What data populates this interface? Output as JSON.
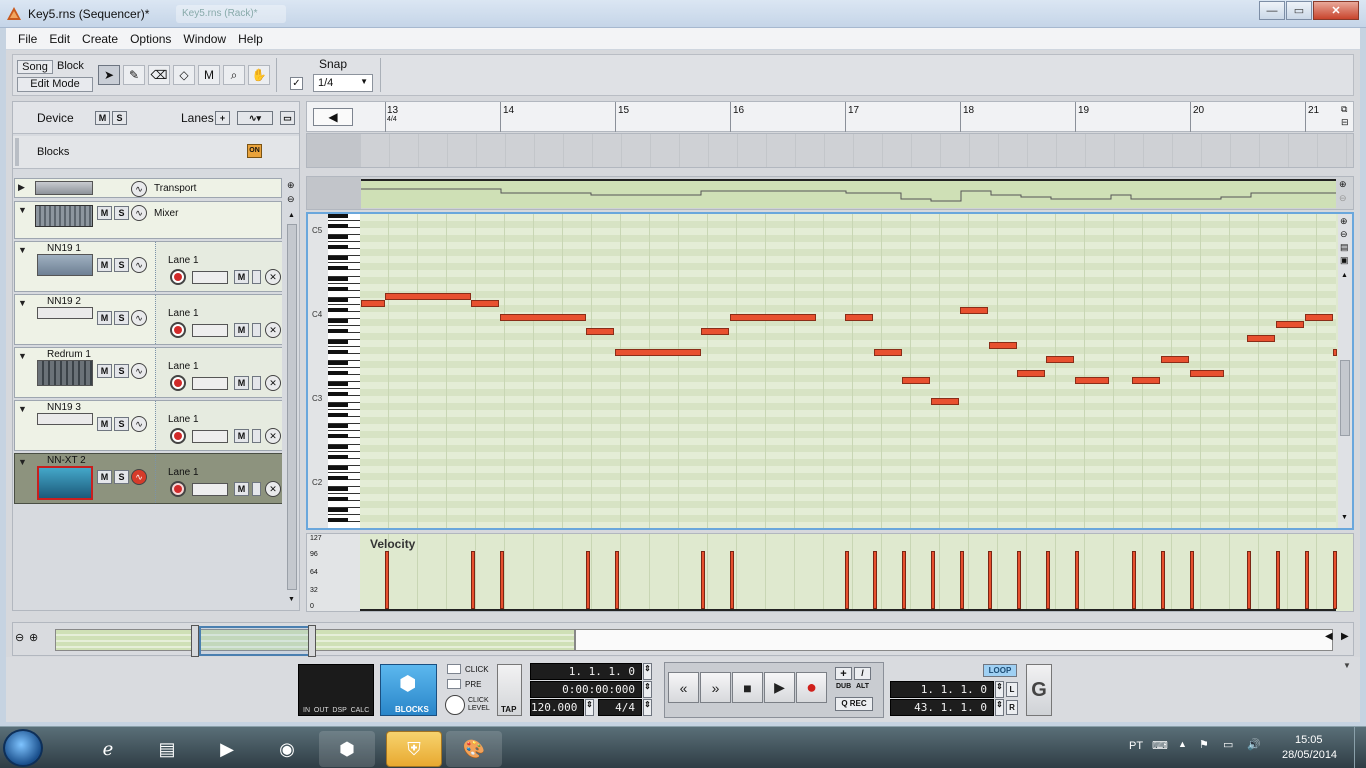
{
  "window": {
    "title": "Key5.rns (Sequencer)*",
    "background_title": "Key5.rns (Rack)*"
  },
  "menu": [
    "File",
    "Edit",
    "Create",
    "Options",
    "Window",
    "Help"
  ],
  "toolbar": {
    "song_label": "Song",
    "block_label": "Block",
    "edit_mode_label": "Edit Mode",
    "snap_label": "Snap",
    "snap_value": "1/4",
    "snap_checked": "✓"
  },
  "tracklist": {
    "device_label": "Device",
    "lanes_label": "Lanes",
    "m_label": "M",
    "s_label": "S",
    "blocks_label": "Blocks",
    "blocks_on": "ON",
    "tracks": [
      {
        "name": "Transport",
        "lane": ""
      },
      {
        "name": "Mixer",
        "lane": ""
      },
      {
        "name": "NN19 1",
        "lane": "Lane 1"
      },
      {
        "name": "NN19 2",
        "lane": "Lane 1"
      },
      {
        "name": "Redrum 1",
        "lane": "Lane 1"
      },
      {
        "name": "NN19 3",
        "lane": "Lane 1"
      },
      {
        "name": "NN-XT 2",
        "lane": "Lane 1"
      }
    ]
  },
  "ruler": {
    "bars": [
      "13",
      "14",
      "15",
      "16",
      "17",
      "18",
      "19",
      "20",
      "21"
    ],
    "time_signature": "4/4"
  },
  "pianoroll": {
    "octave_labels": [
      "C5",
      "C4",
      "C3",
      "C2"
    ]
  },
  "velocity": {
    "title": "Velocity",
    "scale": [
      "127",
      "96",
      "64",
      "32",
      "0"
    ]
  },
  "transport": {
    "click_label": "CLICK",
    "pre_label": "PRE",
    "click_level_label": "CLICK LEVEL",
    "tap_label": "TAP",
    "blocks_label": "BLOCKS",
    "io_labels": "IN  OUT  DSP  CALC",
    "position": "1. 1. 1.   0",
    "time": "0:00:00:000",
    "tempo": "120.000",
    "signature": "4/4",
    "dub_label": "DUB",
    "alt_label": "ALT",
    "qrec_label": "Q REC",
    "loop_label": "LOOP",
    "loop_left": "1. 1. 1.   0",
    "loop_right": "43. 1. 1.   0",
    "l_label": "L",
    "r_label": "R"
  },
  "taskbar": {
    "language": "PT",
    "time": "15:05",
    "date": "28/05/2014"
  }
}
